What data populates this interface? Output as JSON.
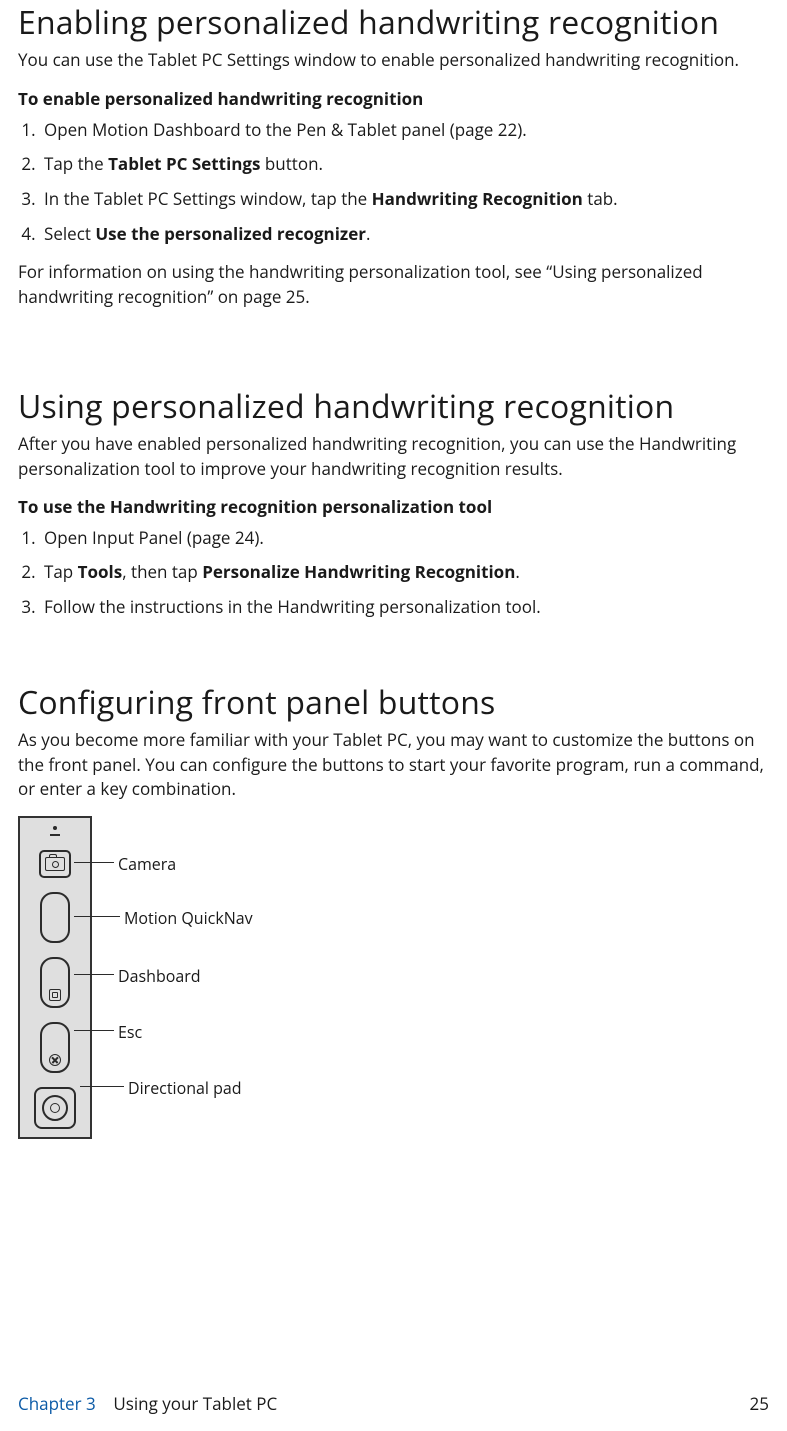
{
  "section1": {
    "title": "Enabling personalized handwriting recognition",
    "lead": "You can use the Tablet PC Settings window to enable personalized handwriting recognition.",
    "subhead": "To enable personalized handwriting recognition",
    "steps": {
      "s1": "Open Motion Dashboard to the Pen & Tablet panel (page 22).",
      "s2_a": "Tap the ",
      "s2_b": "Tablet PC Settings",
      "s2_c": " button.",
      "s3_a": "In the Tablet PC Settings window, tap the ",
      "s3_b": "Handwriting Recognition",
      "s3_c": " tab.",
      "s4_a": "Select ",
      "s4_b": "Use the personalized recognizer",
      "s4_c": "."
    },
    "followup": "For information on using the handwriting personalization tool, see “Using personalized handwriting recognition” on page 25."
  },
  "section2": {
    "title": "Using personalized handwriting recognition",
    "lead": "After you have enabled personalized handwriting recognition, you can use the Handwriting personalization tool to improve your handwriting recognition results.",
    "subhead": "To use the Handwriting recognition personalization tool",
    "steps": {
      "s1": "Open Input Panel (page 24).",
      "s2_a": "Tap ",
      "s2_b": "Tools",
      "s2_c": ", then tap ",
      "s2_d": "Personalize Handwriting Recognition",
      "s2_e": ".",
      "s3": "Follow the instructions in the Handwriting personalization tool."
    }
  },
  "section3": {
    "title": "Configuring front panel buttons",
    "lead": "As you become more familiar with your Tablet PC, you may want to customize the buttons on the front panel. You can configure the buttons to start your favorite program, run a command, or enter a key combination.",
    "labels": {
      "camera": "Camera",
      "quicknav": "Motion QuickNav",
      "dashboard": "Dashboard",
      "esc": "Esc",
      "dpad": "Directional pad"
    }
  },
  "footer": {
    "chapter": "Chapter 3",
    "chapter_title": "Using your Tablet PC",
    "page": "25"
  }
}
